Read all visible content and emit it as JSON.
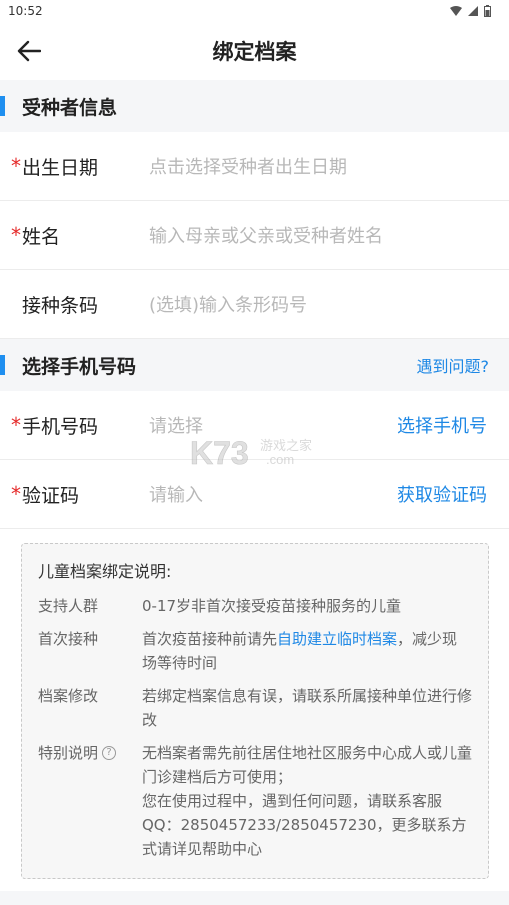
{
  "status": {
    "time": "10:52"
  },
  "nav": {
    "title": "绑定档案"
  },
  "recipient": {
    "section_title": "受种者信息",
    "birth": {
      "required": "*",
      "label": "出生日期",
      "placeholder": "点击选择受种者出生日期"
    },
    "name": {
      "required": "*",
      "label": "姓名",
      "placeholder": "输入母亲或父亲或受种者姓名"
    },
    "barcode": {
      "label": "接种条码",
      "placeholder": "(选填)输入条形码号"
    }
  },
  "phone_section": {
    "section_title": "选择手机号码",
    "help": "遇到问题?",
    "phone": {
      "required": "*",
      "label": "手机号码",
      "placeholder": "请选择",
      "action": "选择手机号"
    },
    "code": {
      "required": "*",
      "label": "验证码",
      "placeholder": "请输入",
      "action": "获取验证码"
    }
  },
  "notice": {
    "title": "儿童档案绑定说明:",
    "items": [
      {
        "key": "支持人群",
        "value": "0-17岁非首次接受疫苗接种服务的儿童"
      },
      {
        "key": "首次接种",
        "value_pre": "首次疫苗接种前请先",
        "value_link": "自助建立临时档案",
        "value_post": "，减少现场等待时间"
      },
      {
        "key": "档案修改",
        "value": "若绑定档案信息有误，请联系所属接种单位进行修改"
      },
      {
        "key": "特别说明",
        "icon": "question-icon",
        "value": "无档案者需先前往居住地社区服务中心成人或儿童门诊建档后方可使用；",
        "value2": "您在使用过程中，遇到任何问题，请联系客服QQ：2850457233/2850457230，更多联系方式请详见帮助中心"
      }
    ]
  },
  "watermark": {
    "text": "K73",
    "subtext": "游戏之家",
    "domain": ".com"
  },
  "colors": {
    "accent": "#1e88e5",
    "required": "#e52a2a"
  }
}
